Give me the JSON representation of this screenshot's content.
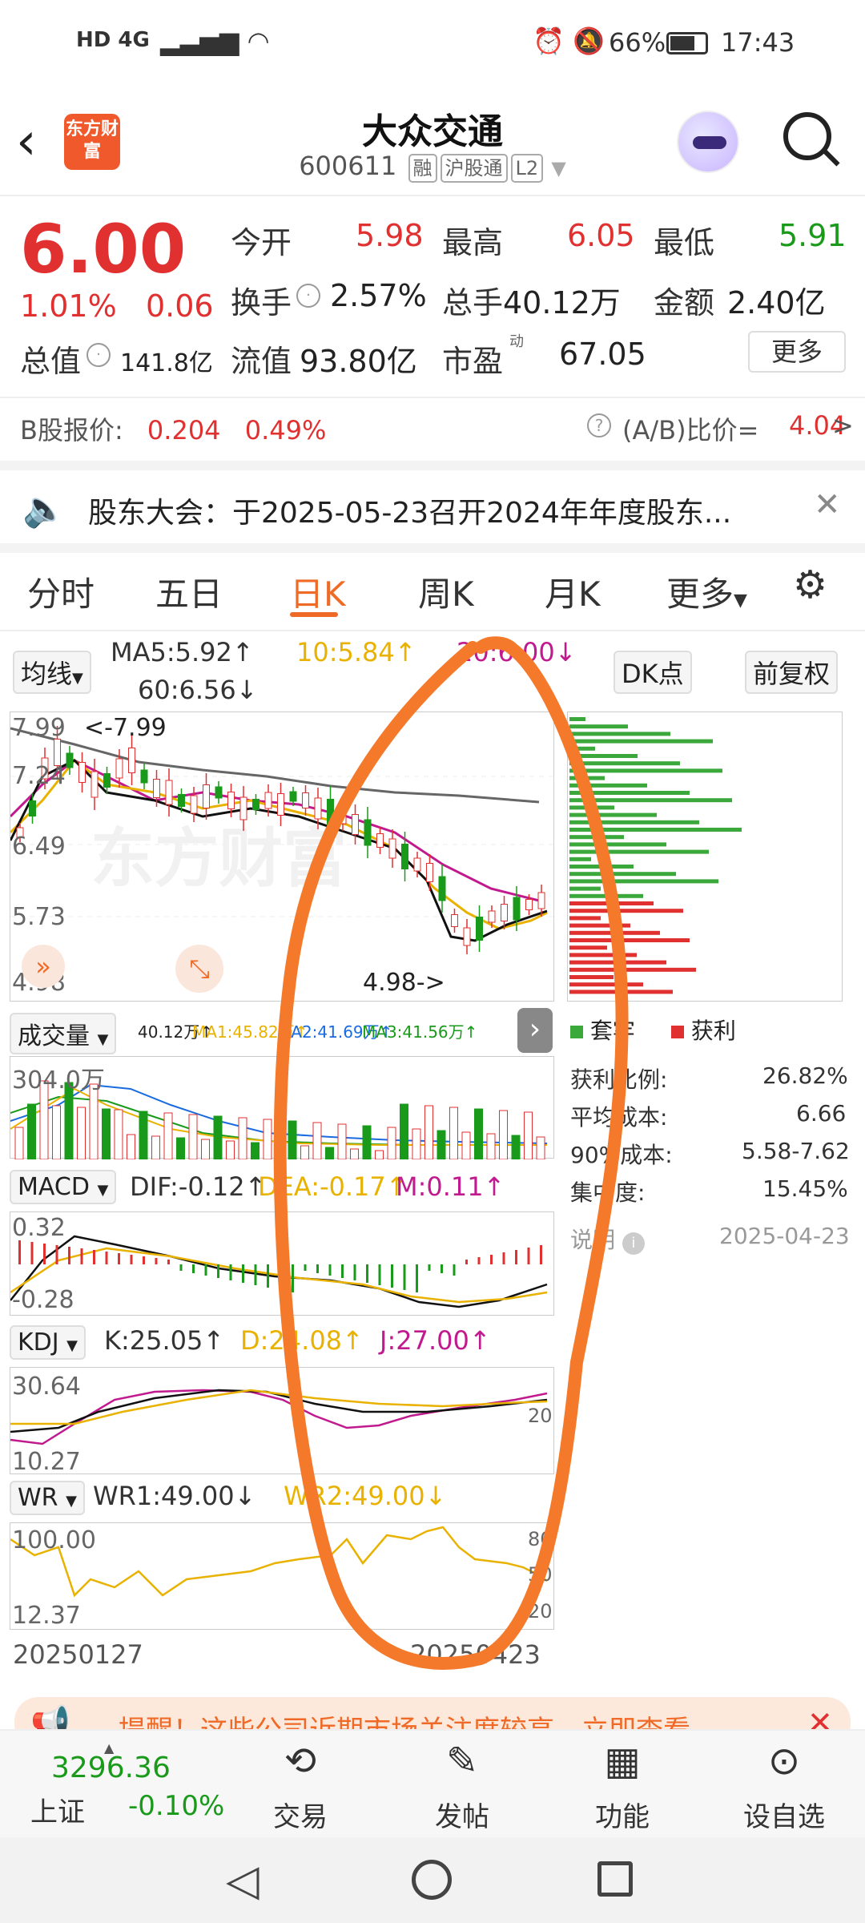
{
  "status": {
    "left_icons": "HD 4G",
    "battery": "66%",
    "time": "17:43"
  },
  "header": {
    "logo_text": "东方财富",
    "name": "大众交通",
    "code": "600611",
    "tags": [
      "融",
      "沪股通",
      "L2"
    ]
  },
  "quote": {
    "price": "6.00",
    "change_pct": "1.01%",
    "change": "0.06",
    "open_lbl": "今开",
    "open": "5.98",
    "high_lbl": "最高",
    "high": "6.05",
    "low_lbl": "最低",
    "low": "5.91",
    "turnover_lbl": "换手",
    "turnover": "2.57%",
    "vol_lbl": "总手",
    "vol": "40.12万",
    "amt_lbl": "金额",
    "amt": "2.40亿",
    "mcap_lbl": "总值",
    "mcap": "141.8亿",
    "float_lbl": "流值",
    "float": "93.80亿",
    "pe_lbl": "市盈",
    "pe_sup": "动",
    "pe": "67.05",
    "more": "更多"
  },
  "bshare": {
    "label": "B股报价:",
    "price": "0.204",
    "pct": "0.49%",
    "ratio_lbl": "(A/B)比价=",
    "ratio": "4.04",
    "arrow": ">"
  },
  "notice": {
    "text": "股东大会：于2025-05-23召开2024年年度股东..."
  },
  "tabs": [
    "分时",
    "五日",
    "日K",
    "周K",
    "月K",
    "更多"
  ],
  "ma": {
    "btn": "均线",
    "ma5": "MA5:5.92↑",
    "ma10": "10:5.84↑",
    "ma20": "20:6.00↓",
    "ma60": "60:6.56↓",
    "dk": "DK点",
    "fq": "前复权"
  },
  "kline": {
    "y_top": "7.99",
    "y_2": "7.24",
    "y_3": "6.49",
    "y_4": "5.73",
    "y_bot": "4.98",
    "hi_mark": "<-7.99",
    "lo_mark": "4.98->"
  },
  "volume": {
    "btn": "成交量",
    "vals": "40.12万↑",
    "ma1": "MA1:45.82万↑",
    "ma2": "MA2:41.69万↑",
    "ma3": "MA3:41.56万↑",
    "y_top": "304.0万"
  },
  "macd": {
    "btn": "MACD",
    "dif": "DIF:-0.12↑",
    "dea": "DEA:-0.17↑",
    "m": "M:0.11↑",
    "y_top": "0.32",
    "y_bot": "-0.28"
  },
  "kdj": {
    "btn": "KDJ",
    "k": "K:25.05↑",
    "d": "D:24.08↑",
    "j": "J:27.00↑",
    "y_top": "30.64",
    "y_bot": "10.27",
    "r_mid": "20"
  },
  "wr": {
    "btn": "WR",
    "wr1": "WR1:49.00↓",
    "wr2": "WR2:49.00↓",
    "y_top": "100.00",
    "y_bot": "12.37",
    "r1": "80",
    "r2": "50",
    "r3": "20"
  },
  "dates": {
    "start": "20250127",
    "end": "20250423"
  },
  "chip": {
    "legend_trap": "套牢",
    "legend_profit": "获利",
    "rows": [
      [
        "获利比例:",
        "26.82%"
      ],
      [
        "平均成本:",
        "6.66"
      ],
      [
        "90%成本:",
        "5.58-7.62"
      ],
      [
        "集中度:",
        "15.45%"
      ]
    ],
    "note": "说明",
    "date": "2025-04-23"
  },
  "banner": {
    "text": "提醒！这些公司近期市场关注度较高，立即查看"
  },
  "bottom": {
    "index_val": "3296.36",
    "index_name": "上证",
    "index_pct": "-0.10%",
    "items": [
      "交易",
      "发帖",
      "功能",
      "设自选"
    ]
  },
  "colors": {
    "up": "#e03030",
    "down": "#1a9a1a",
    "accent": "#ef6a26",
    "annotation": "#f5792a"
  }
}
